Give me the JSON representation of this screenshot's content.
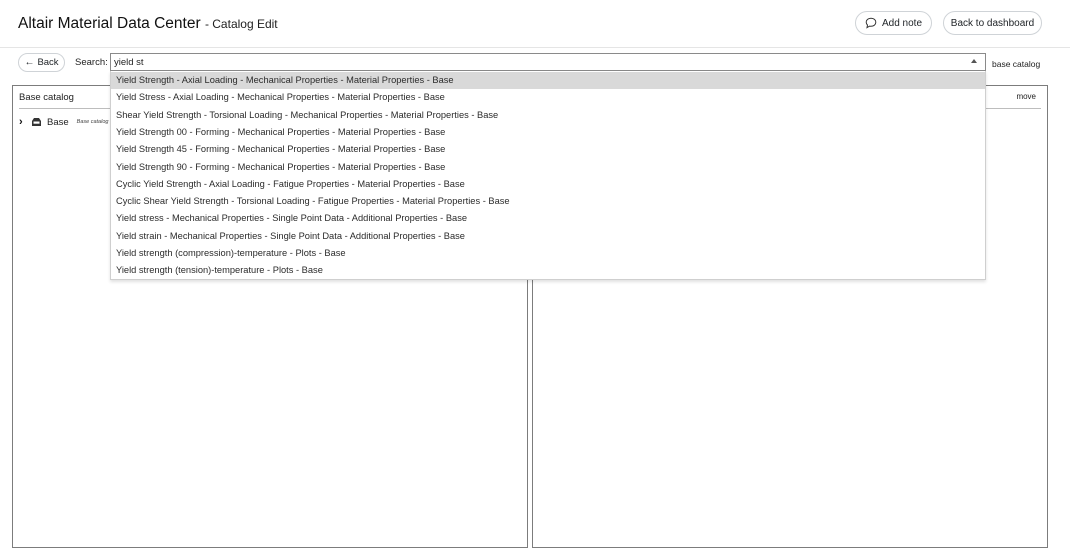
{
  "header": {
    "title": "Altair Material Data Center",
    "subtitle": "- Catalog Edit",
    "add_note_label": "Add note",
    "back_dashboard_label": "Back to dashboard"
  },
  "toolbar": {
    "back_label": "Back",
    "search_label": "Search:",
    "search_value": "yield st",
    "scope_label": "base catalog"
  },
  "left_panel": {
    "title": "Base catalog",
    "tree": [
      {
        "label": "Base",
        "tag": "Base catalog",
        "icon": "database-icon",
        "expand_icon": "chevron-right-icon"
      }
    ]
  },
  "right_panel": {
    "action_label": "move"
  },
  "dropdown": {
    "selected_index": 0,
    "options": [
      "Yield Strength - Axial Loading - Mechanical Properties - Material Properties - Base",
      "Yield Stress - Axial Loading - Mechanical Properties - Material Properties - Base",
      "Shear Yield Strength - Torsional Loading - Mechanical Properties - Material Properties - Base",
      "Yield Strength 00 - Forming - Mechanical Properties - Material Properties - Base",
      "Yield Strength 45 - Forming - Mechanical Properties - Material Properties - Base",
      "Yield Strength 90 - Forming - Mechanical Properties - Material Properties - Base",
      "Cyclic Yield Strength - Axial Loading - Fatigue Properties - Material Properties - Base",
      "Cyclic Shear Yield Strength - Torsional Loading - Fatigue Properties - Material Properties - Base",
      "Yield stress - Mechanical Properties - Single Point Data - Additional Properties - Base",
      "Yield strain - Mechanical Properties - Single Point Data - Additional Properties - Base",
      "Yield strength (compression)-temperature - Plots - Base",
      "Yield strength (tension)-temperature - Plots - Base"
    ]
  },
  "colors": {
    "selected_option_bg": "#d9d9d9",
    "panel_border": "#7c7c7c",
    "button_border": "#cfd3d7"
  }
}
